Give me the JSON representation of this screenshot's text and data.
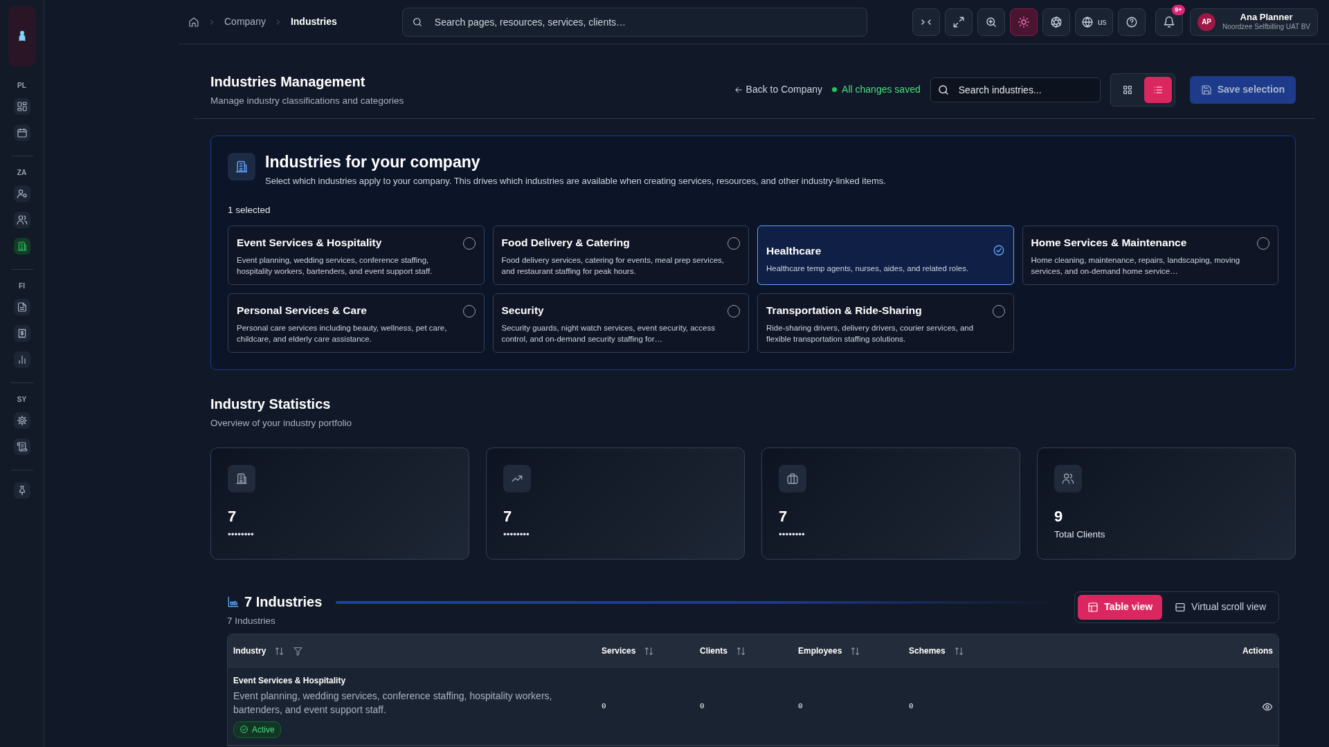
{
  "sidebar": {
    "sections": [
      {
        "label": "PL",
        "items": [
          {
            "selected": false
          },
          {
            "selected": false
          }
        ]
      },
      {
        "label": "ZA",
        "items": [
          {
            "selected": false
          },
          {
            "selected": false
          },
          {
            "selected": true
          }
        ]
      },
      {
        "label": "FI",
        "items": [
          {
            "selected": false
          },
          {
            "selected": false
          },
          {
            "selected": false
          }
        ]
      },
      {
        "label": "SY",
        "items": [
          {
            "selected": false
          },
          {
            "selected": false
          }
        ]
      }
    ]
  },
  "breadcrumb": [
    {
      "label": "Company",
      "current": false
    },
    {
      "label": "Industries",
      "current": true
    }
  ],
  "search": {
    "placeholder": "Search pages, resources, services, clients…"
  },
  "toolbar": {
    "language": "us",
    "notifications": "9+"
  },
  "user": {
    "initials": "AP",
    "name": "Ana Planner",
    "company": "Noordzee Selfbilling UAT BV"
  },
  "header": {
    "title": "Industries Management",
    "subtitle": "Manage industry classifications and categories",
    "back_link": "Back to Company",
    "save_status": "All changes saved",
    "search_placeholder": "Search industries...",
    "view_modes": [
      {
        "selected": false
      },
      {
        "selected": true
      }
    ],
    "save_button": "Save selection"
  },
  "panel": {
    "title": "Industries for your company",
    "description": "Select which industries apply to your company. This drives which industries are available when creating services, resources, and other industry-linked items.",
    "selected_count": "1 selected",
    "industries": [
      {
        "name": "Event Services & Hospitality",
        "description": "Event planning, wedding services, conference staffing, hospitality workers, bartenders, and event support staff.",
        "selected": false
      },
      {
        "name": "Food Delivery & Catering",
        "description": "Food delivery services, catering for events, meal prep services, and restaurant staffing for peak hours.",
        "selected": false
      },
      {
        "name": "Healthcare",
        "description": "Healthcare temp agents, nurses, aides, and related roles.",
        "selected": true
      },
      {
        "name": "Home Services & Maintenance",
        "description": "Home cleaning, maintenance, repairs, landscaping, moving services, and on-demand home service…",
        "selected": false
      },
      {
        "name": "Personal Services & Care",
        "description": "Personal care services including beauty, wellness, pet care, childcare, and elderly care assistance.",
        "selected": false
      },
      {
        "name": "Security",
        "description": "Security guards, night watch services, event security, access control, and on-demand security staffing for…",
        "selected": false
      },
      {
        "name": "Transportation & Ride-Sharing",
        "description": "Ride-sharing drivers, delivery drivers, courier services, and flexible transportation staffing solutions.",
        "selected": false
      }
    ]
  },
  "statistics": {
    "title": "Industry Statistics",
    "subtitle": "Overview of your industry portfolio",
    "cards": [
      {
        "value": "7",
        "label": "••••••••"
      },
      {
        "value": "7",
        "label": "••••••••"
      },
      {
        "value": "7",
        "label": "••••••••"
      },
      {
        "value": "9",
        "label": "Total Clients"
      }
    ]
  },
  "list": {
    "title": "7 Industries",
    "subtitle": "7 Industries",
    "views": [
      {
        "label": "Table view",
        "selected": true
      },
      {
        "label": "Virtual scroll view",
        "selected": false
      }
    ],
    "columns": [
      {
        "label": "Industry",
        "kind": "text"
      },
      {
        "label": "Services",
        "kind": "num"
      },
      {
        "label": "Clients",
        "kind": "num"
      },
      {
        "label": "Employees",
        "kind": "num"
      },
      {
        "label": "Schemes",
        "kind": "num"
      },
      {
        "label": "Actions",
        "kind": "actions"
      }
    ],
    "rows": [
      {
        "name": "Event Services & Hospitality",
        "description": "Event planning, wedding services, conference staffing, hospitality workers, bartenders, and event support staff.",
        "status": "Active",
        "services": "0",
        "clients": "0",
        "employees": "0",
        "schemes": "0"
      }
    ]
  }
}
